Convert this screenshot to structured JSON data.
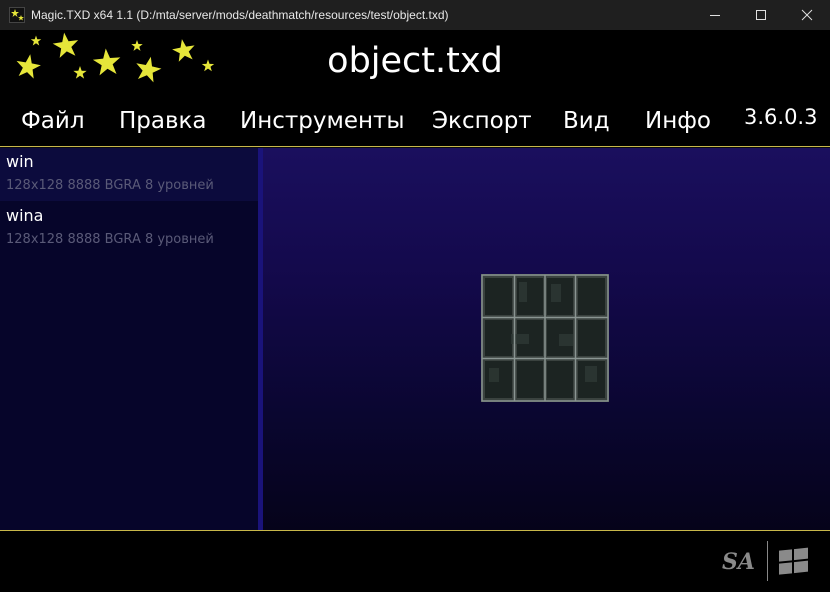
{
  "window": {
    "title": "Magic.TXD x64 1.1 (D:/mta/server/mods/deathmatch/resources/test/object.txd)",
    "controls": [
      "minimize",
      "maximize",
      "close"
    ]
  },
  "header": {
    "file_title": "object.txd"
  },
  "menu": {
    "items": [
      {
        "label": "Файл"
      },
      {
        "label": "Правка"
      },
      {
        "label": "Инструменты"
      },
      {
        "label": "Экспорт"
      },
      {
        "label": "Вид"
      },
      {
        "label": "Инфо"
      }
    ],
    "version": "3.6.0.3"
  },
  "textures": [
    {
      "name": "win",
      "info": "128x128 8888 BGRA 8 уровней",
      "selected": true
    },
    {
      "name": "wina",
      "info": "128x128 8888 BGRA 8 уровней",
      "selected": false
    }
  ],
  "colors": {
    "accent_line": "#c8b84a",
    "star": "#e6e63a",
    "list_bg": "#06052a",
    "selected_bg": "#0c0b3d"
  },
  "icons": {
    "app": "magic-txd-star-icon",
    "footer_left": "sa-game-logo",
    "footer_right": "windows-logo"
  }
}
